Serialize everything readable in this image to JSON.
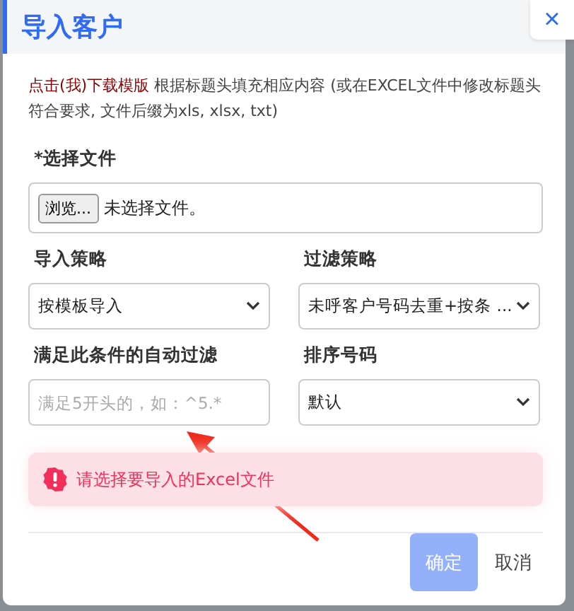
{
  "dialog": {
    "title": "导入客户",
    "close": "×"
  },
  "intro": {
    "link": "点击(我)下载模版",
    "text": "根据标题头填充相应内容 (或在EXCEL文件中修改标题头符合要求, 文件后缀为xls, xlsx, txt)"
  },
  "file": {
    "label": "*选择文件",
    "button": "浏览...",
    "status": "未选择文件。"
  },
  "fields": [
    {
      "label": "导入策略",
      "kind": "select",
      "value": "按模板导入"
    },
    {
      "label": "过滤策略",
      "kind": "select",
      "value": "未呼客户号码去重+按条 ..."
    },
    {
      "label": "满足此条件的自动过滤",
      "kind": "input",
      "placeholder": "满足5开头的，如：^5.*"
    },
    {
      "label": "排序号码",
      "kind": "select",
      "value": "默认"
    }
  ],
  "alert": {
    "message": "请选择要导入的Excel文件"
  },
  "buttons": [
    {
      "label": "确定",
      "kind": "primary",
      "disabled": true
    },
    {
      "label": "取消",
      "kind": "text",
      "disabled": false
    }
  ]
}
